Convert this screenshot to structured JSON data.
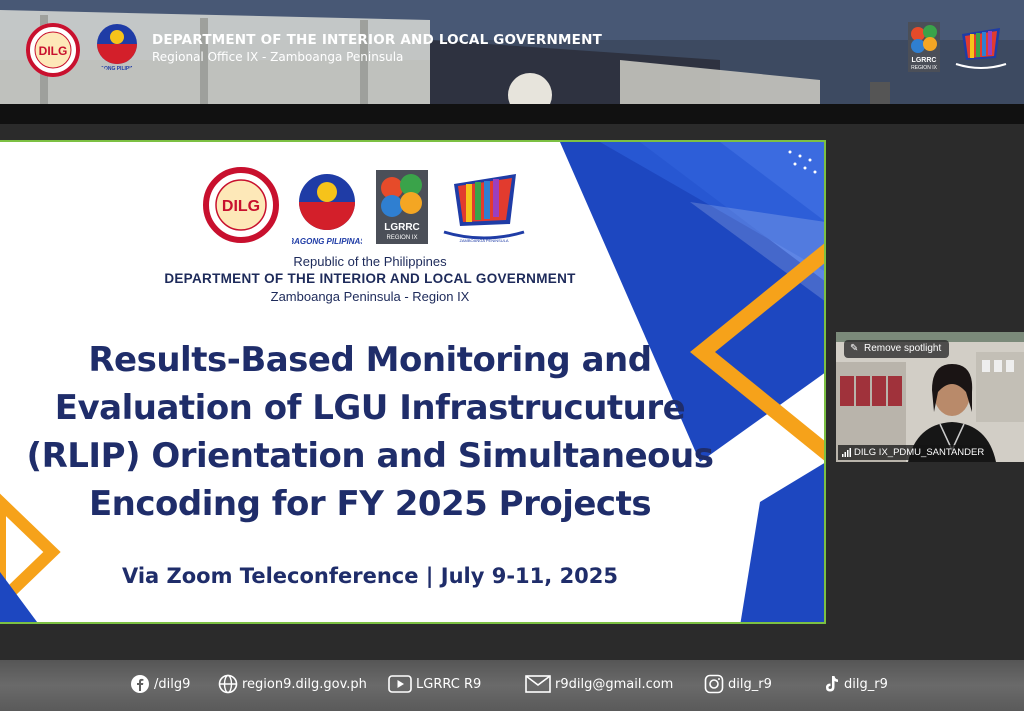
{
  "header": {
    "title": "DEPARTMENT OF THE INTERIOR AND LOCAL GOVERNMENT",
    "subtitle": "Regional Office IX - Zamboanga Peninsula",
    "logo_dilg_text": "DILG",
    "logo_lgrrc_text": "LGRRC",
    "logo_lgrrc_sub": "REGION IX"
  },
  "slide": {
    "logo_dilg_text": "DILG",
    "bagong_pilipinas": "BAGONG PILIPINAS",
    "lgrrc_text": "LGRRC",
    "lgrrc_sub": "REGION IX",
    "republic": "Republic of the Philippines",
    "department": "DEPARTMENT OF THE INTERIOR AND LOCAL GOVERNMENT",
    "region": "Zamboanga Peninsula - Region IX",
    "title_lines": [
      "Results-Based Monitoring and",
      "Evaluation of LGU Infrastrucuture",
      "(RLIP) Orientation and Simultaneous",
      "Encoding for FY 2025 Projects"
    ],
    "via": "Via Zoom Teleconference | July 9-11, 2025"
  },
  "video_tile": {
    "spotlight_button": "Remove spotlight",
    "participant_name": "DILG IX_PDMU_SANTANDER"
  },
  "footer": {
    "facebook": "/dilg9",
    "website": "region9.dilg.gov.ph",
    "youtube": "LGRRC R9",
    "email": "r9dilg@gmail.com",
    "instagram": "dilg_r9",
    "tiktok": "dilg_r9"
  },
  "colors": {
    "navy": "#1f2d6a",
    "blue": "#1f4fc4",
    "orange": "#f6a21a",
    "green_border": "#7cc043",
    "dilg_red": "#c8102e"
  }
}
